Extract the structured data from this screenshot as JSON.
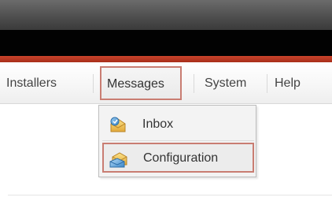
{
  "menu": {
    "items": [
      {
        "label": "Installers"
      },
      {
        "label": "Messages"
      },
      {
        "label": "System"
      },
      {
        "label": "Help"
      }
    ],
    "active": "Messages"
  },
  "dropdown": {
    "items": [
      {
        "label": "Inbox",
        "icon": "inbox-icon"
      },
      {
        "label": "Configuration",
        "icon": "configuration-icon"
      }
    ],
    "highlighted": "Configuration"
  },
  "colors": {
    "accent_red": "#b5341f",
    "highlight_border": "#c97d72",
    "top_bar": "#4f4f4f"
  }
}
